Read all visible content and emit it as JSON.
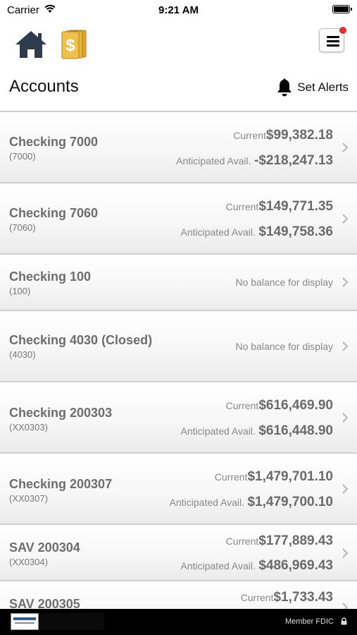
{
  "status_bar": {
    "carrier": "Carrier",
    "time": "9:21 AM"
  },
  "header": {
    "title": "Accounts",
    "set_alerts": "Set Alerts"
  },
  "icons": {
    "home": "home-icon",
    "dollar": "dollar-icon",
    "menu": "menu-icon",
    "bell": "bell-icon",
    "chevron": "chevron-right-icon",
    "lock": "lock-icon"
  },
  "accounts": [
    {
      "name": "Checking 7000",
      "number": "(7000)",
      "current_label": "Current",
      "current": "$99,382.18",
      "anticipated_label": "Anticipated Avail.",
      "anticipated": "-$218,247.13"
    },
    {
      "name": "Checking 7060",
      "number": "(7060)",
      "current_label": "Current",
      "current": "$149,771.35",
      "anticipated_label": "Anticipated Avail.",
      "anticipated": "$149,758.36"
    },
    {
      "name": "Checking 100",
      "number": "(100)",
      "no_balance": "No balance for display"
    },
    {
      "name": "Checking 4030 (Closed)",
      "number": "(4030)",
      "no_balance": "No balance for display"
    },
    {
      "name": "Checking 200303",
      "number": "(XX0303)",
      "current_label": "Current",
      "current": "$616,469.90",
      "anticipated_label": "Anticipated Avail.",
      "anticipated": "$616,448.90"
    },
    {
      "name": "Checking 200307",
      "number": "(XX0307)",
      "current_label": "Current",
      "current": "$1,479,701.10",
      "anticipated_label": "Anticipated Avail.",
      "anticipated": "$1,479,700.10"
    },
    {
      "name": "SAV 200304",
      "number": "(XX0304)",
      "current_label": "Current",
      "current": "$177,889.43",
      "anticipated_label": "Anticipated Avail.",
      "anticipated": "$486,969.43"
    },
    {
      "name": "SAV 200305",
      "current_label": "Current",
      "current": "$1,733.43"
    }
  ],
  "footer": {
    "member_fdic": "Member FDIC"
  },
  "colors": {
    "notification_dot": "#e53030",
    "dollar_gold": "#e0b23a",
    "footer_bg": "#000000"
  }
}
